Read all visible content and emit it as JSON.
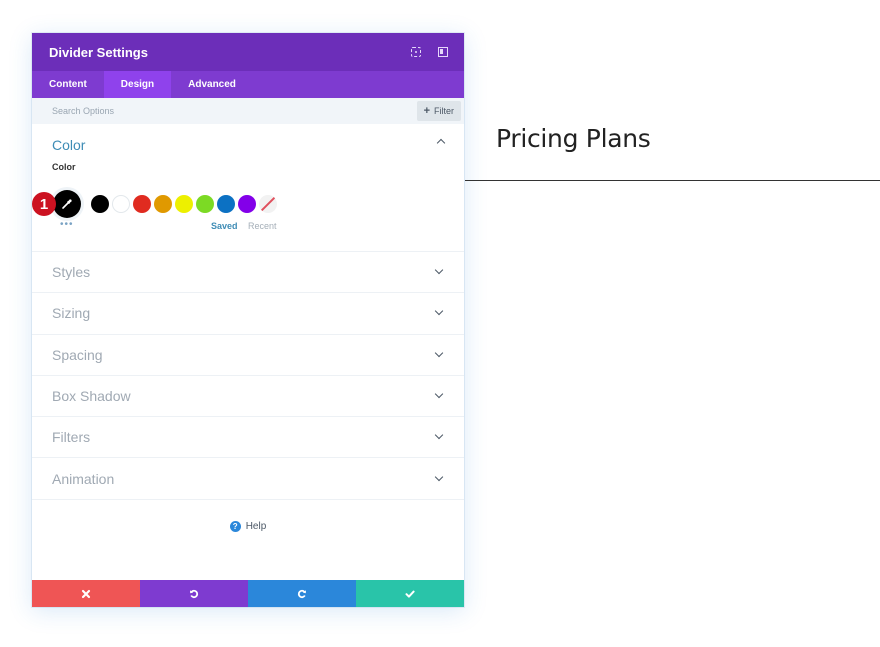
{
  "panel": {
    "title": "Divider Settings",
    "header_icons": [
      "expand-icon",
      "columns-icon"
    ],
    "tabs": [
      {
        "label": "Content",
        "active": false
      },
      {
        "label": "Design",
        "active": true
      },
      {
        "label": "Advanced",
        "active": false
      }
    ],
    "search": {
      "placeholder": "Search Options",
      "value": ""
    },
    "filter_label": "Filter",
    "color_section": {
      "title": "Color",
      "field_label": "Color",
      "badge": "1",
      "selected_color": "#000000",
      "swatches": [
        "#000000",
        "#ffffff",
        "#e02b20",
        "#e09900",
        "#edf000",
        "#7cda24",
        "#0c71c3",
        "#8300e9",
        "none"
      ],
      "saved_label": "Saved",
      "recent_label": "Recent",
      "more_label": "•••"
    },
    "sections": [
      {
        "label": "Styles"
      },
      {
        "label": "Sizing"
      },
      {
        "label": "Spacing"
      },
      {
        "label": "Box Shadow"
      },
      {
        "label": "Filters"
      },
      {
        "label": "Animation"
      }
    ],
    "help_label": "Help",
    "footer": {
      "cancel_color": "#ef5555",
      "undo_color": "#7e3bd0",
      "redo_color": "#2b87da",
      "save_color": "#29c4a9"
    }
  },
  "preview": {
    "heading": "Pricing Plans"
  }
}
